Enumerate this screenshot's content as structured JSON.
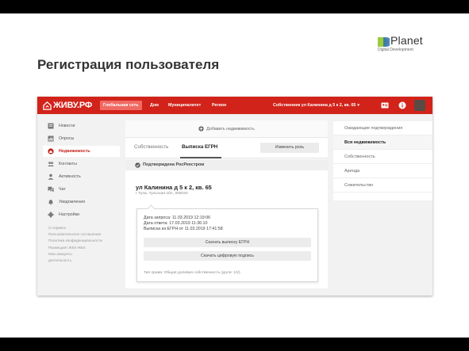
{
  "slide": {
    "title": "Регистрация пользователя",
    "logo": {
      "name": "Planet",
      "subtitle": "Digital Development"
    }
  },
  "app": {
    "brand": "ЖИВУ.РФ",
    "nav": [
      "Глобальная сеть",
      "Дом",
      "Муниципалитет",
      "Регион"
    ],
    "owner": "Собственник ул Калинина д 5 к 2, кв. 65",
    "sidebar": {
      "items": [
        {
          "label": "Новости",
          "icon": "newspaper-icon"
        },
        {
          "label": "Опросы",
          "icon": "poll-icon"
        },
        {
          "label": "Недвижимость",
          "icon": "home-pin-icon"
        },
        {
          "label": "Контакты",
          "icon": "contacts-icon"
        },
        {
          "label": "Активность",
          "icon": "person-icon"
        },
        {
          "label": "Чат",
          "icon": "chat-icon"
        },
        {
          "label": "Уведомления",
          "icon": "bell-icon"
        },
        {
          "label": "Настройки",
          "icon": "gear-icon"
        }
      ],
      "links": [
        "О сервисе",
        "Пользовательское соглашение",
        "Политика конфиденциальности",
        "Размещает ЖКХ-ЖКХ",
        "Мои аккаунты",
        "деятельность"
      ]
    },
    "content": {
      "add_label": "Добавить недвижимость",
      "tabs": [
        "Собственность",
        "Выписка ЕГРН"
      ],
      "role_button": "Изменить роль",
      "verified": "Подтверждена РосРеестром",
      "address": "ул Калинина д 5 к 2, кв. 65",
      "address_sub": "г Тула, Тульская обл, 300040",
      "card": {
        "lines": [
          "Дата запроса: 11.03.2019 12:19:06",
          "Дата ответа: 17.03.2019 11:36:10",
          "Выписка из ЕГРН от 11.03.2019 17:41:58"
        ],
        "buttons": [
          "Скачать выписку ЕГРН",
          "Скачать цифровую подпись"
        ],
        "footer": "Тип права: Общая долевая собственность (доля: 1/2)"
      }
    },
    "filters": [
      "Ожидающие подтверждения",
      "Вся недвижимость",
      "Собственность",
      "Аренда",
      "Сожительство"
    ],
    "filters_active": "Вся недвижимость"
  },
  "colors": {
    "brand_red": "#d2231a",
    "nav_active": "#f06a63"
  }
}
